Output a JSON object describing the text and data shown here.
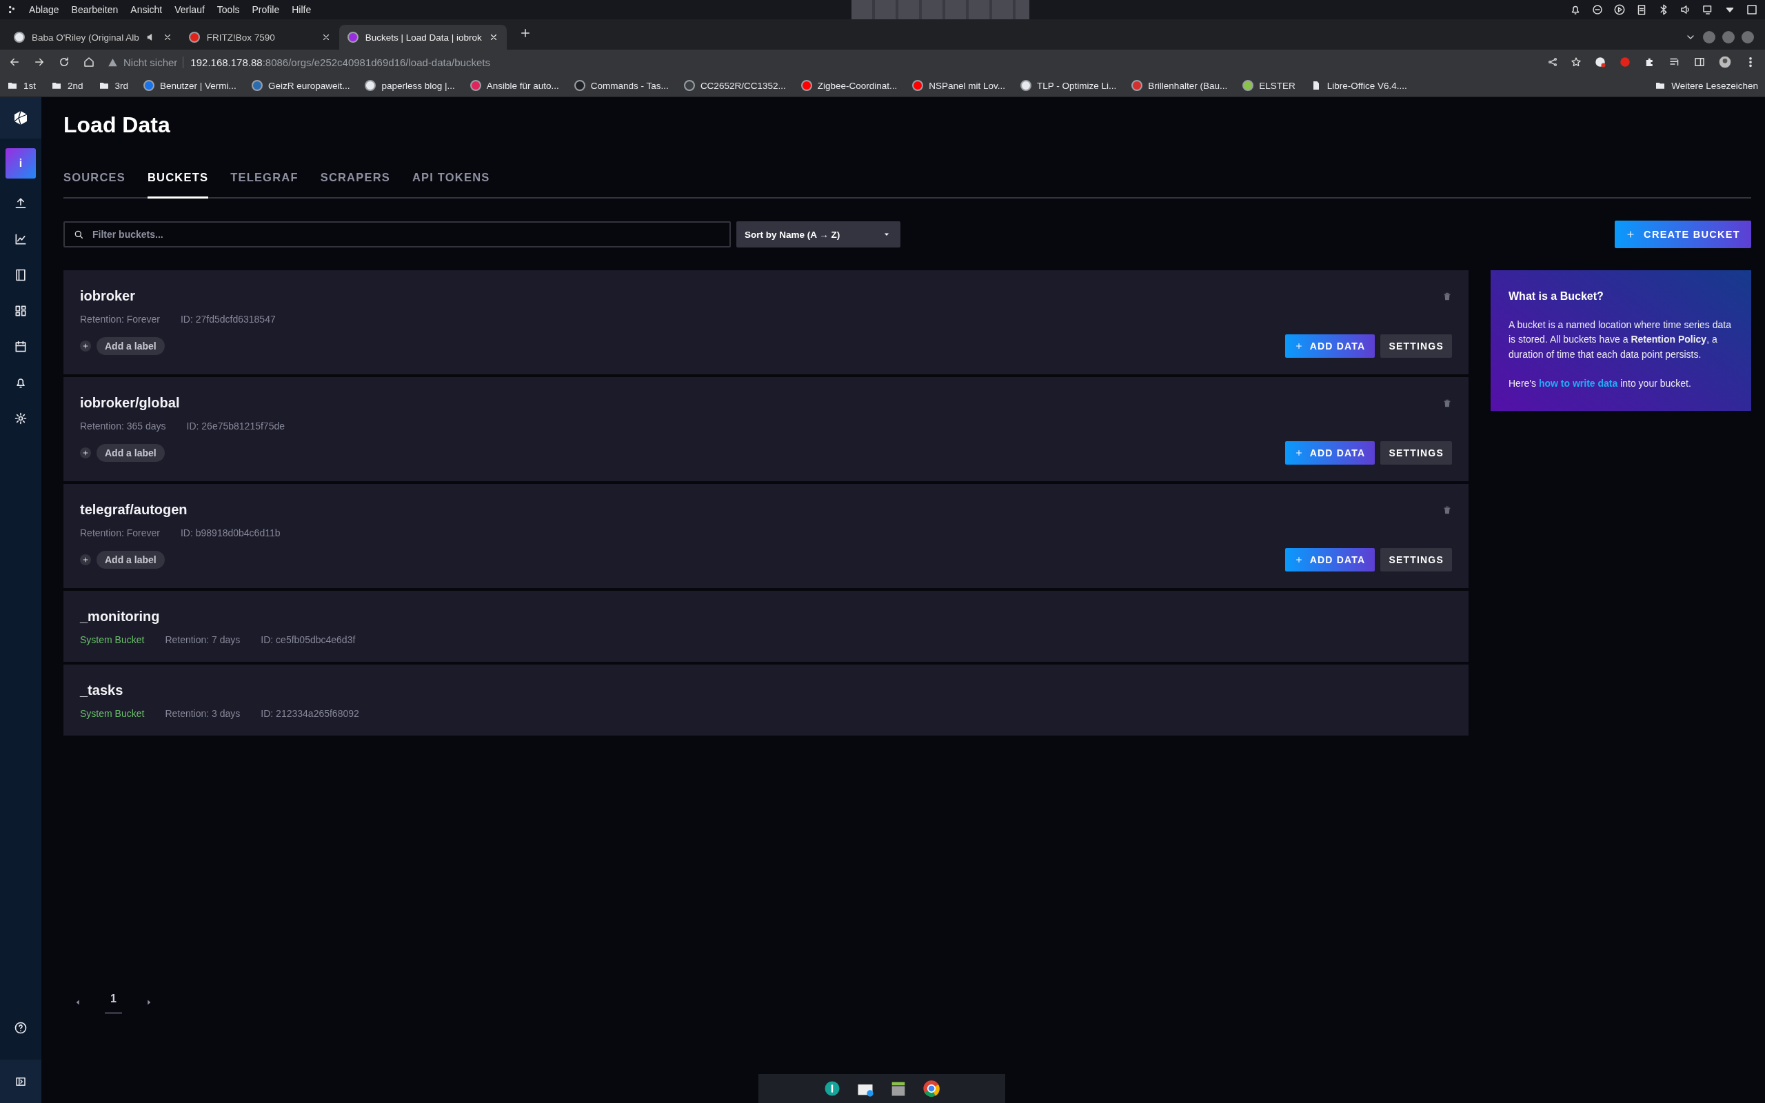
{
  "os_menu": [
    "Ablage",
    "Bearbeiten",
    "Ansicht",
    "Verlauf",
    "Tools",
    "Profile",
    "Hilfe"
  ],
  "browser_tabs": [
    {
      "title": "Baba O'Riley (Original Alb",
      "selected": false,
      "playing": true,
      "color": "#e8eaed"
    },
    {
      "title": "FRITZ!Box 7590",
      "selected": false,
      "playing": false,
      "color": "#e2231a"
    },
    {
      "title": "Buckets | Load Data | iobrok",
      "selected": true,
      "playing": false,
      "color": "#9b2de0"
    }
  ],
  "address": {
    "security": "Nicht sicher",
    "host": "192.168.178.88",
    "path": ":8086/orgs/e252c40981d69d16/load-data/buckets"
  },
  "bookmarks": [
    {
      "label": "1st",
      "kind": "folder"
    },
    {
      "label": "2nd",
      "kind": "folder"
    },
    {
      "label": "3rd",
      "kind": "folder"
    },
    {
      "label": "Benutzer | Vermi...",
      "kind": "site",
      "color": "#1a73e8"
    },
    {
      "label": "GeizR europaweit...",
      "kind": "site",
      "color": "#2b6cb0"
    },
    {
      "label": "paperless blog |...",
      "kind": "site",
      "color": "#e8eaed"
    },
    {
      "label": "Ansible für auto...",
      "kind": "site",
      "color": "#e2245c"
    },
    {
      "label": "Commands - Tas...",
      "kind": "site",
      "color": "#202124"
    },
    {
      "label": "CC2652R/CC1352...",
      "kind": "site",
      "color": "#3c4043"
    },
    {
      "label": "Zigbee-Coordinat...",
      "kind": "site",
      "color": "#ff0000"
    },
    {
      "label": "NSPanel mit Lov...",
      "kind": "site",
      "color": "#ff0000"
    },
    {
      "label": "TLP - Optimize Li...",
      "kind": "site",
      "color": "#e8eaed"
    },
    {
      "label": "Brillenhalter (Bau...",
      "kind": "site",
      "color": "#d32f2f"
    },
    {
      "label": "ELSTER",
      "kind": "site",
      "color": "#8bc34a"
    },
    {
      "label": "Libre-Office V6.4....",
      "kind": "doc"
    }
  ],
  "other_bookmarks": "Weitere Lesezeichen",
  "org_avatar": "i",
  "page_title": "Load Data",
  "tabs": [
    {
      "label": "SOURCES",
      "selected": false
    },
    {
      "label": "BUCKETS",
      "selected": true
    },
    {
      "label": "TELEGRAF",
      "selected": false
    },
    {
      "label": "SCRAPERS",
      "selected": false
    },
    {
      "label": "API TOKENS",
      "selected": false
    }
  ],
  "filter": {
    "placeholder": "Filter buckets..."
  },
  "sort": {
    "value": "Sort by Name (A → Z)"
  },
  "create_button": "CREATE BUCKET",
  "buckets": [
    {
      "kind": "user",
      "name": "iobroker",
      "retention": "Retention: Forever",
      "id": "ID: 27fd5dcfd6318547",
      "add_label": "Add a label",
      "add_data": "ADD DATA",
      "settings": "SETTINGS"
    },
    {
      "kind": "user",
      "name": "iobroker/global",
      "retention": "Retention: 365 days",
      "id": "ID: 26e75b81215f75de",
      "add_label": "Add a label",
      "add_data": "ADD DATA",
      "settings": "SETTINGS"
    },
    {
      "kind": "user",
      "name": "telegraf/autogen",
      "retention": "Retention: Forever",
      "id": "ID: b98918d0b4c6d11b",
      "add_label": "Add a label",
      "add_data": "ADD DATA",
      "settings": "SETTINGS"
    },
    {
      "kind": "system",
      "name": "_monitoring",
      "badge": "System Bucket",
      "retention": "Retention: 7 days",
      "id": "ID: ce5fb05dbc4e6d3f"
    },
    {
      "kind": "system",
      "name": "_tasks",
      "badge": "System Bucket",
      "retention": "Retention: 3 days",
      "id": "ID: 212334a265f68092"
    }
  ],
  "info_panel": {
    "title": "What is a Bucket?",
    "body": "A bucket is a named location where time series data is stored. All buckets have a **Retention Policy**, a duration of time that each data point persists.",
    "link_before": "Here's",
    "link": "how to write data",
    "link_after": "into your bucket."
  },
  "pagination": {
    "pages": [
      {
        "label": "1",
        "selected": true
      }
    ]
  }
}
